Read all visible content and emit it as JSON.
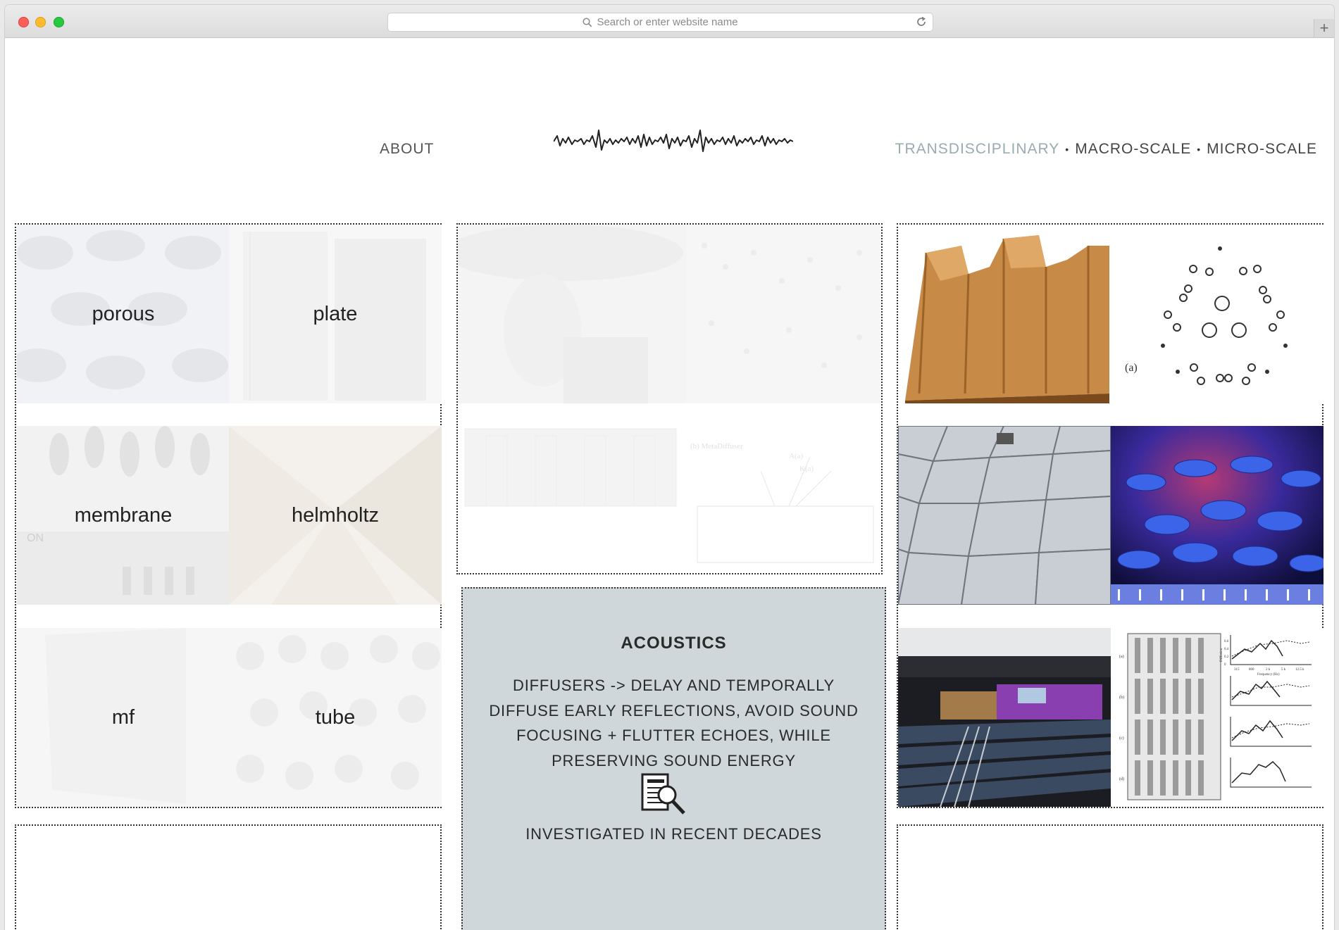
{
  "browser": {
    "url_placeholder": "Search or enter website name",
    "new_tab": "+"
  },
  "nav": {
    "about": "ABOUT",
    "right": [
      {
        "label": "TRANSDISCIPLINARY",
        "active": true
      },
      {
        "label": "MACRO-SCALE",
        "active": false
      },
      {
        "label": "MICRO-SCALE",
        "active": false
      }
    ],
    "separator": "•"
  },
  "absorbers": [
    {
      "label": "porous"
    },
    {
      "label": "plate"
    },
    {
      "label": "membrane"
    },
    {
      "label": "helmholtz"
    },
    {
      "label": "mf"
    },
    {
      "label": "tube"
    }
  ],
  "card": {
    "title": "ACOUSTICS",
    "body": "DIFFUSERS -> DELAY AND TEMPORALLY DIFFUSE EARLY REFLECTIONS, AVOID SOUND FOCUSING + FLUTTER ECHOES, WHILE PRESERVING SOUND ENERGY",
    "footer": "INVESTIGATED IN RECENT DECADES"
  },
  "figure_labels": {
    "circle_array": "(a)",
    "metadiffuser": "(b) MetaDiffuser",
    "vector_a": "A(a)",
    "vector_b": "K(a)",
    "graph_rows": [
      "(a)",
      "(b)",
      "(c)",
      "(d)"
    ],
    "graph_ylabel": "Diffusion",
    "graph_xlabel": "Frequency (Hz)",
    "graph_ticks": [
      "315",
      "800",
      "2 k",
      "5 k",
      "12.5 k"
    ],
    "graph_yticks": [
      "0.6",
      "0.4",
      "0.2",
      "0"
    ],
    "on_sign": "ON"
  }
}
